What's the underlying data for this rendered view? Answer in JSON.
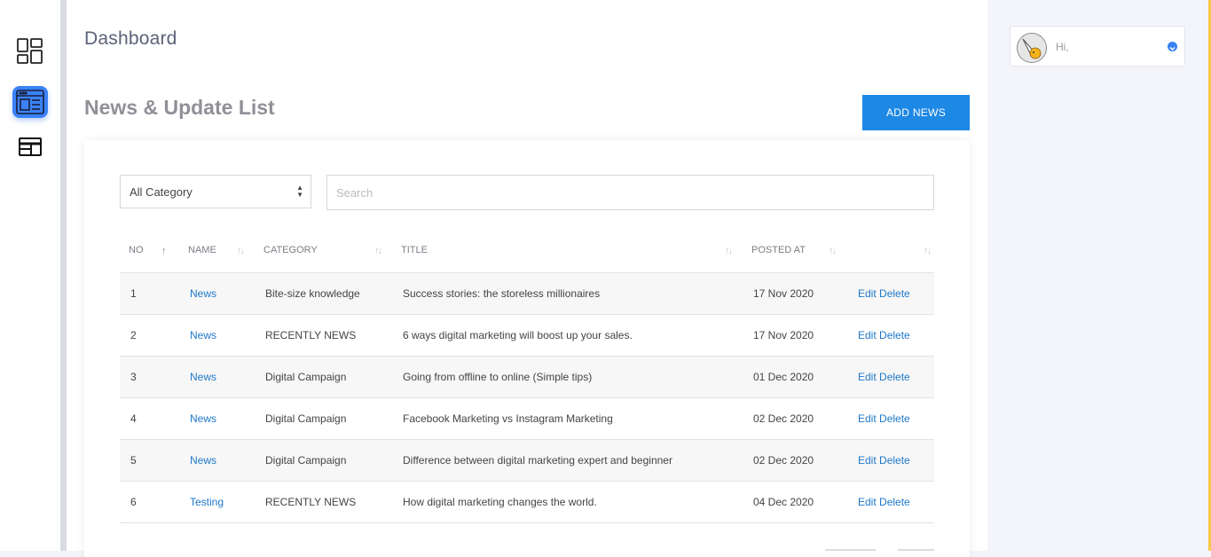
{
  "sidebar": {
    "items": [
      {
        "icon": "dashboard-icon",
        "active": false
      },
      {
        "icon": "news-window-icon",
        "active": true
      },
      {
        "icon": "browser-window-icon",
        "active": false
      }
    ]
  },
  "header": {
    "title": "Dashboard"
  },
  "section": {
    "title": "News & Update List",
    "add_button": "ADD NEWS"
  },
  "filters": {
    "category_selected": "All Category",
    "search_placeholder": "Search"
  },
  "table": {
    "columns": [
      "NO",
      "NAME",
      "CATEGORY",
      "TITLE",
      "POSTED AT",
      ""
    ],
    "rows": [
      {
        "no": "1",
        "name": "News",
        "category": "Bite-size knowledge",
        "title": "Success stories: the storeless millionaires",
        "posted": "17 Nov 2020",
        "edit": "Edit",
        "delete": "Delete"
      },
      {
        "no": "2",
        "name": "News",
        "category": "RECENTLY NEWS",
        "title": "6 ways digital marketing will boost up your sales.",
        "posted": "17 Nov 2020",
        "edit": "Edit",
        "delete": "Delete"
      },
      {
        "no": "3",
        "name": "News",
        "category": "Digital Campaign",
        "title": "Going from offline to online (Simple tips)",
        "posted": "01 Dec 2020",
        "edit": "Edit",
        "delete": "Delete"
      },
      {
        "no": "4",
        "name": "News",
        "category": "Digital Campaign",
        "title": "Facebook Marketing vs Instagram Marketing",
        "posted": "02 Dec 2020",
        "edit": "Edit",
        "delete": "Delete"
      },
      {
        "no": "5",
        "name": "News",
        "category": "Digital Campaign",
        "title": "Difference between digital marketing expert and beginner",
        "posted": "02 Dec 2020",
        "edit": "Edit",
        "delete": "Delete"
      },
      {
        "no": "6",
        "name": "Testing",
        "category": "RECENTLY NEWS",
        "title": "How digital marketing changes the world.",
        "posted": "04 Dec 2020",
        "edit": "Edit",
        "delete": "Delete"
      }
    ]
  },
  "user": {
    "greeting": "Hi,"
  },
  "colors": {
    "accent": "#1e88e5",
    "link": "#1e78c8",
    "active_icon_bg": "#3b82f6"
  }
}
